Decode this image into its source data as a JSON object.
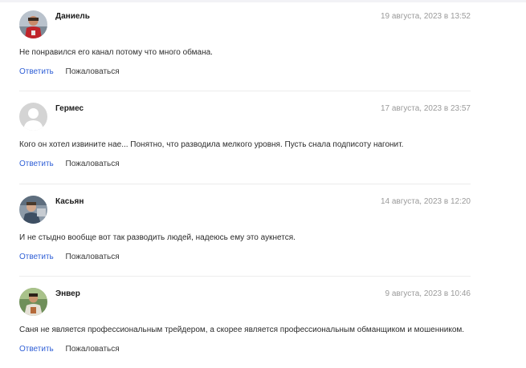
{
  "comments": [
    {
      "author": "Даниель",
      "date": "19 августа, 2023 в 13:52",
      "text": "Не понравился его канал потому что много обмана.",
      "reply_label": "Ответить",
      "report_label": "Пожаловаться",
      "avatar": "photo-red-shirt"
    },
    {
      "author": "Гермес",
      "date": "17 августа, 2023 в 23:57",
      "text": "Кого он хотел извините нае... Понятно, что разводила мелкого уровня. Пусть снала подписоту нагонит.",
      "reply_label": "Ответить",
      "report_label": "Пожаловаться",
      "avatar": "default-user-icon"
    },
    {
      "author": "Касьян",
      "date": "14 августа, 2023 в 12:20",
      "text": "И не стыдно вообще вот так разводить людей, надеюсь ему это аукнется.",
      "reply_label": "Ответить",
      "report_label": "Пожаловаться",
      "avatar": "photo-blue-gray"
    },
    {
      "author": "Энвер",
      "date": "9 августа, 2023 в 10:46",
      "text": "Саня не является профессиональным трейдером, а скорее является профессиональным обманщиком и мошенником.",
      "reply_label": "Ответить",
      "report_label": "Пожаловаться",
      "avatar": "photo-outdoor-green"
    }
  ],
  "colors": {
    "link_blue": "#2f5fd6",
    "date_gray": "#9a9a9a",
    "divider": "#ececec"
  }
}
